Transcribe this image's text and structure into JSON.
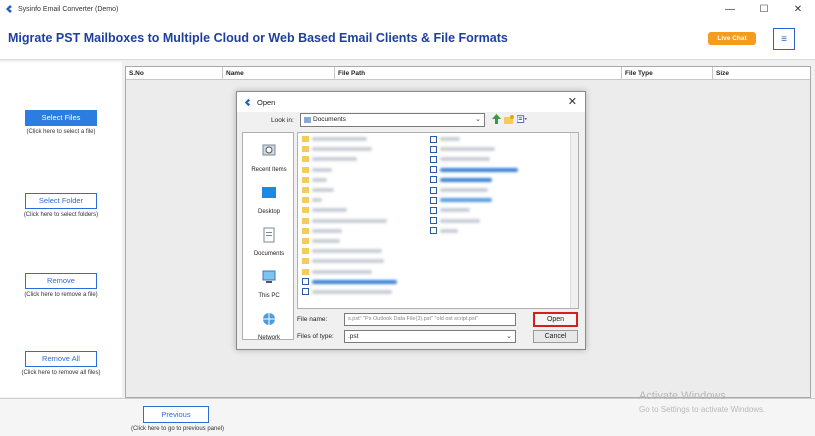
{
  "window": {
    "title": "Sysinfo Email Converter (Demo)",
    "minimize": "—",
    "maximize": "☐",
    "close": "✕"
  },
  "header": {
    "headline": "Migrate PST Mailboxes to Multiple Cloud or Web Based Email Clients & File Formats",
    "live_chat": "Live Chat",
    "menu_icon": "≡"
  },
  "left_panel": {
    "actions": [
      {
        "label": "Select Files",
        "hint": "(Click here to select a file)"
      },
      {
        "label": "Select Folder",
        "hint": "(Click here to select folders)"
      },
      {
        "label": "Remove",
        "hint": "(Click here to remove a file)"
      },
      {
        "label": "Remove All",
        "hint": "(Click here to remove all files)"
      }
    ]
  },
  "grid": {
    "columns": [
      "S.No",
      "Name",
      "File Path",
      "File Type",
      "Size"
    ]
  },
  "bottom": {
    "previous_label": "Previous",
    "previous_hint": "(Click here to go to previous panel)"
  },
  "watermark": {
    "line1": "Activate Windows",
    "line2": "Go to Settings to activate Windows."
  },
  "dialog": {
    "title": "Open",
    "close": "✕",
    "look_in_label": "Look in:",
    "look_in_value": "Documents",
    "places": [
      "Recent Items",
      "Desktop",
      "Documents",
      "This PC",
      "Network"
    ],
    "file_name_label": "File name:",
    "file_name_value": "s.pst\" \"Ps Outlook Data File(3).pst\" \"old ost script.pst\"",
    "files_of_type_label": "Files of type:",
    "files_of_type_value": ".pst",
    "open_label": "Open",
    "cancel_label": "Cancel"
  },
  "colors": {
    "accent": "#2b7de2",
    "headline": "#1f3f9e",
    "live_chat": "#f59b1d",
    "open_highlight": "#d62020"
  }
}
